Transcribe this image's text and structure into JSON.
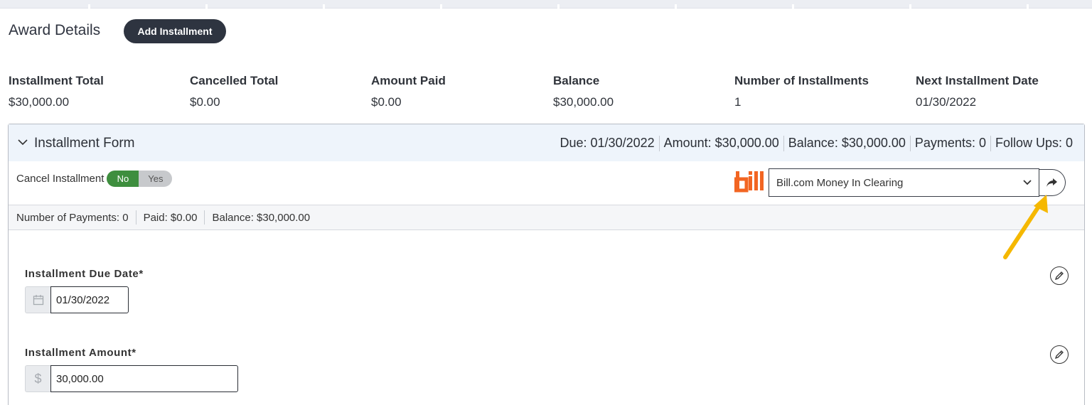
{
  "header": {
    "title": "Award Details",
    "add_button": "Add Installment"
  },
  "summary": [
    {
      "label": "Installment Total",
      "value": "$30,000.00"
    },
    {
      "label": "Cancelled Total",
      "value": "$0.00"
    },
    {
      "label": "Amount Paid",
      "value": "$0.00"
    },
    {
      "label": "Balance",
      "value": "$30,000.00"
    },
    {
      "label": "Number of Installments",
      "value": "1"
    },
    {
      "label": "Next Installment Date",
      "value": "01/30/2022"
    }
  ],
  "form": {
    "title": "Installment Form",
    "head_stats": [
      "Due: 01/30/2022",
      "Amount: $30,000.00",
      "Balance: $30,000.00",
      "Payments: 0",
      "Follow Ups: 0"
    ],
    "cancel": {
      "label": "Cancel Installment",
      "no": "No",
      "yes": "Yes",
      "selected": "No"
    },
    "account": {
      "logo_text": "bill",
      "selected": "Bill.com Money In Clearing"
    },
    "payment_bar": [
      "Number of Payments: 0",
      "Paid: $0.00",
      "Balance: $30,000.00"
    ],
    "due_date": {
      "label": "Installment Due Date*",
      "value": "01/30/2022"
    },
    "amount": {
      "label": "Installment Amount*",
      "addon": "$",
      "value": "30,000.00"
    }
  },
  "colors": {
    "accent_dark": "#2e3440",
    "toggle_on": "#3e8e3e",
    "bill_logo": "#f26522",
    "header_bg": "#eef4fb",
    "annotation_arrow": "#f5b800"
  }
}
